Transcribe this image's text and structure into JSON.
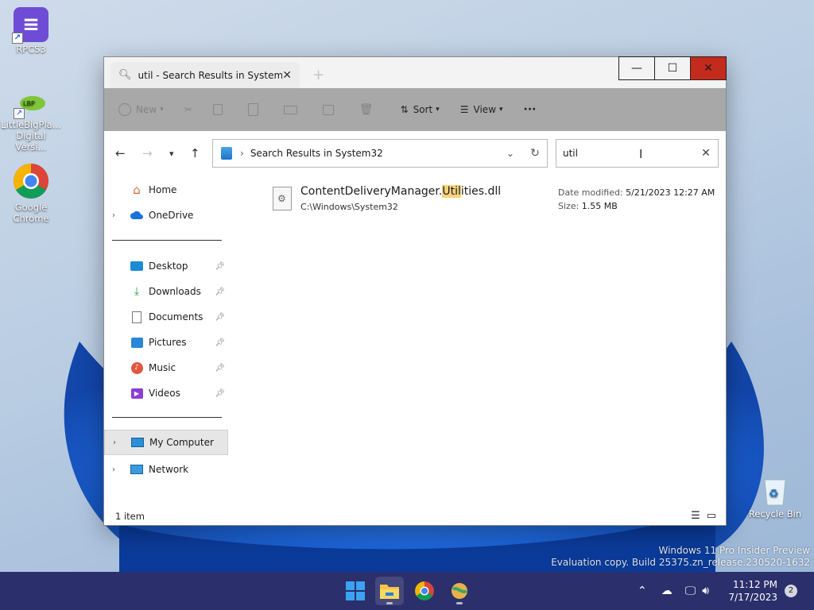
{
  "desktop": {
    "icons": [
      {
        "label": "RPCS3",
        "icon": "rpcs3-icon",
        "accent": "#6f4cd6"
      },
      {
        "label": "LittleBigPla...\nDigital Versi...",
        "icon": "littlebigplanet-icon"
      },
      {
        "label": "Google\nChrome",
        "icon": "chrome-icon"
      },
      {
        "label": "Recycle Bin",
        "icon": "recycle-bin-icon"
      }
    ],
    "watermark_line1": "Windows 11 Pro Insider Preview",
    "watermark_line2": "Evaluation copy. Build 25375.zn_release.230520-1632"
  },
  "window": {
    "tab_title": "util - Search Results in System",
    "new_tab_glyph": "+",
    "minimize_glyph": "—",
    "maximize_glyph": "☐",
    "close_glyph": "✕",
    "toolbar": {
      "new_label": "New",
      "sort_label": "Sort",
      "view_label": "View",
      "more_label": "···"
    },
    "address": {
      "path": "Search Results in System32"
    },
    "search": {
      "value": "util"
    },
    "sidebar": {
      "home": "Home",
      "onedrive": "OneDrive",
      "quick_access": [
        {
          "label": "Desktop",
          "icon": "desktop-folder-icon"
        },
        {
          "label": "Downloads",
          "icon": "downloads-icon"
        },
        {
          "label": "Documents",
          "icon": "documents-icon"
        },
        {
          "label": "Pictures",
          "icon": "pictures-icon"
        },
        {
          "label": "Music",
          "icon": "music-icon"
        },
        {
          "label": "Videos",
          "icon": "videos-icon"
        }
      ],
      "my_computer": "My Computer",
      "network": "Network"
    },
    "result": {
      "name_prefix": "ContentDeliveryManager.",
      "name_match": "Util",
      "name_mid": "ities",
      "name_suffix": ".dll",
      "path": "C:\\Windows\\System32",
      "date_label": "Date modified:",
      "date_value": "5/21/2023 12:27 AM",
      "size_label": "Size:",
      "size_value": "1.55 MB"
    },
    "status": {
      "count": "1 item"
    }
  },
  "taskbar": {
    "time": "11:12 PM",
    "date": "7/17/2023",
    "notifications": "2"
  },
  "colors": {
    "accent": "#0067c0",
    "taskbar": "#2b2f6b",
    "close": "#c42b1c",
    "highlight": "#f6d47a"
  }
}
